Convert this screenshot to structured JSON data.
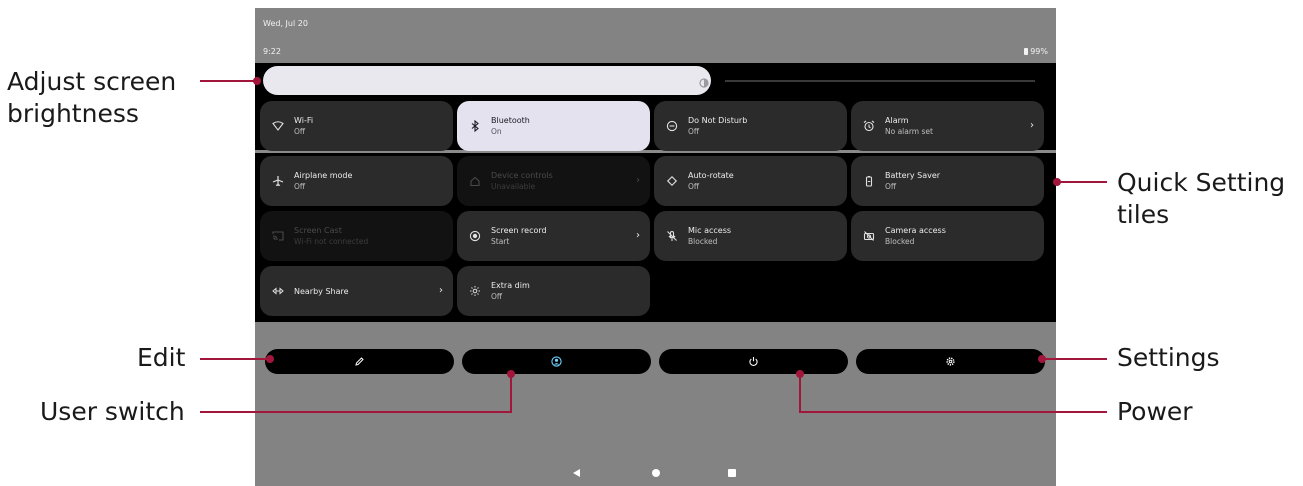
{
  "status_bar": {
    "date": "Wed, Jul 20",
    "time": "9:22",
    "battery": "99%"
  },
  "brightness": {
    "level_percent": 58
  },
  "tiles": [
    {
      "label": "Wi-Fi",
      "sub": "Off",
      "icon": "wifi-icon"
    },
    {
      "label": "Bluetooth",
      "sub": "On",
      "icon": "bluetooth-icon"
    },
    {
      "label": "Do Not Disturb",
      "sub": "Off",
      "icon": "do-not-disturb-icon"
    },
    {
      "label": "Alarm",
      "sub": "No alarm set",
      "icon": "alarm-icon",
      "chevron": "›"
    },
    {
      "label": "Airplane mode",
      "sub": "Off",
      "icon": "airplane-icon"
    },
    {
      "label": "Device controls",
      "sub": "Unavailable",
      "icon": "home-icon",
      "chevron": "›"
    },
    {
      "label": "Auto-rotate",
      "sub": "Off",
      "icon": "rotate-icon"
    },
    {
      "label": "Battery Saver",
      "sub": "Off",
      "icon": "battery-saver-icon"
    },
    {
      "label": "Screen Cast",
      "sub": "Wi-Fi not connected",
      "icon": "cast-icon"
    },
    {
      "label": "Screen record",
      "sub": "Start",
      "icon": "record-icon",
      "chevron": "›"
    },
    {
      "label": "Mic access",
      "sub": "Blocked",
      "icon": "mic-off-icon"
    },
    {
      "label": "Camera access",
      "sub": "Blocked",
      "icon": "camera-off-icon"
    },
    {
      "label": "Nearby Share",
      "sub": "",
      "icon": "nearby-share-icon",
      "chevron": "›"
    },
    {
      "label": "Extra dim",
      "sub": "Off",
      "icon": "extra-dim-icon"
    }
  ],
  "buttons": {
    "edit": "edit-icon",
    "user": "user-switch-icon",
    "power": "power-icon",
    "settings": "gear-icon"
  },
  "callouts": {
    "brightness_line1": "Adjust screen",
    "brightness_line2": "brightness",
    "tiles_line1": "Quick Setting",
    "tiles_line2": "tiles",
    "edit": "Edit",
    "user_switch": "User switch",
    "settings": "Settings",
    "power": "Power"
  },
  "colors": {
    "callout_line": "#a3163b",
    "active_tile": "#e4e2ee",
    "accent_user": "#6fd3ff"
  }
}
